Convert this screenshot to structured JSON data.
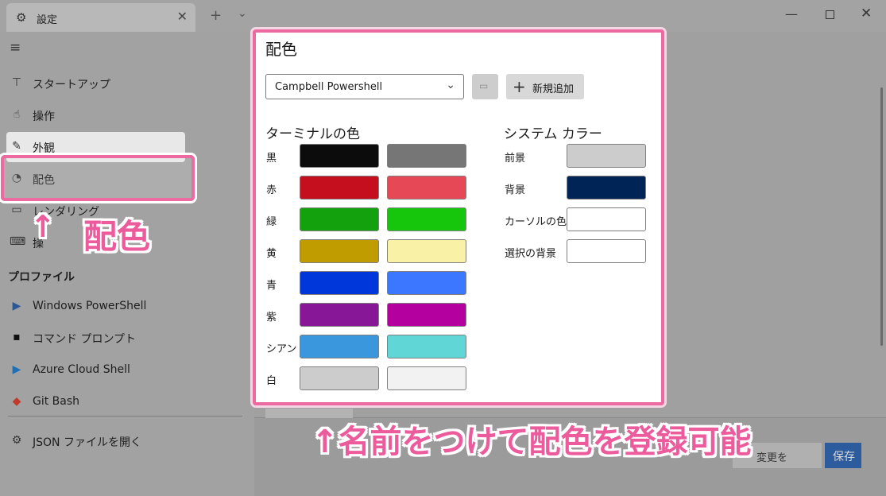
{
  "titlebar": {
    "tab_title": "設定",
    "tab_icon": "gear-icon",
    "close_glyph": "✕",
    "new_tab_glyph": "+",
    "dropdown_glyph": "⌄",
    "minimize_glyph": "—",
    "close_window_glyph": "✕"
  },
  "sidebar": {
    "menu_glyph": "≡",
    "items": [
      {
        "label": "スタートアップ",
        "icon": "startup-icon",
        "glyph": "⊤"
      },
      {
        "label": "操作",
        "icon": "interaction-icon",
        "glyph": "☝"
      },
      {
        "label": "外観",
        "icon": "appearance-icon",
        "glyph": "✎"
      },
      {
        "label": "配色",
        "icon": "palette-icon",
        "glyph": "◔"
      },
      {
        "label": "レンダリング",
        "icon": "rendering-icon",
        "glyph": "▭"
      },
      {
        "label": "操",
        "icon": "keyboard-icon",
        "glyph": "⌨"
      }
    ],
    "profiles_title": "プロファイル",
    "profiles": [
      {
        "label": "Windows PowerShell",
        "icon": "powershell-icon",
        "glyph": "▶"
      },
      {
        "label": "コマンド プロンプト",
        "icon": "cmd-icon",
        "glyph": "▪"
      },
      {
        "label": "Azure Cloud Shell",
        "icon": "azure-icon",
        "glyph": "▶"
      },
      {
        "label": "Git Bash",
        "icon": "git-icon",
        "glyph": "◆"
      }
    ],
    "json_label": "JSON ファイルを開く",
    "json_glyph": "⚙"
  },
  "panel": {
    "title": "配色",
    "scheme_value": "Campbell Powershell",
    "chevron_glyph": "⌄",
    "rename_glyph": "▭",
    "add_glyph": "+",
    "add_label": "新規追加",
    "terminal_colors_title": "ターミナルの色",
    "system_colors_title": "システム カラー",
    "terminal_colors": [
      {
        "label": "黒",
        "normal": "#0c0c0c",
        "bright": "#767676"
      },
      {
        "label": "赤",
        "normal": "#c50f1f",
        "bright": "#e74856"
      },
      {
        "label": "緑",
        "normal": "#13a10e",
        "bright": "#16c60c"
      },
      {
        "label": "黄",
        "normal": "#c19c00",
        "bright": "#f9f1a5"
      },
      {
        "label": "青",
        "normal": "#0037da",
        "bright": "#3b78ff"
      },
      {
        "label": "紫",
        "normal": "#881798",
        "bright": "#b4009e"
      },
      {
        "label": "シアン",
        "normal": "#3a96dd",
        "bright": "#61d6d6"
      },
      {
        "label": "白",
        "normal": "#cccccc",
        "bright": "#f2f2f2"
      }
    ],
    "system_colors": [
      {
        "label": "前景",
        "color": "#cccccc"
      },
      {
        "label": "背景",
        "color": "#012456"
      },
      {
        "label": "カーソルの色",
        "color": "#ffffff"
      },
      {
        "label": "選択の背景",
        "color": "#ffffff"
      }
    ]
  },
  "footer": {
    "save_label": "保存",
    "discard_label": "変更を"
  },
  "annotations": {
    "left_arrow": "↑",
    "left_text": "配色",
    "bottom_text": "↑名前をつけて配色を登録可能"
  },
  "colors": {
    "highlight_pink": "#ec6aa0",
    "accent_blue": "#2c5c9e"
  }
}
